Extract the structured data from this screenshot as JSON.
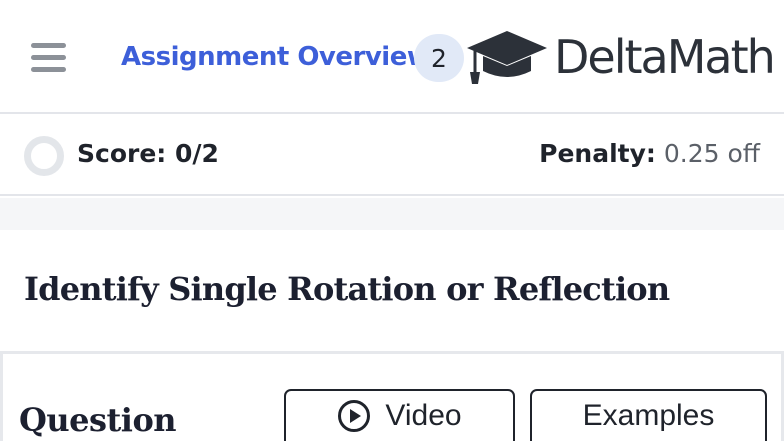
{
  "header": {
    "overview_link": "Assignment Overview",
    "overview_count": "2",
    "logo_text": "DeltaMath",
    "menu_icon": "hamburger-menu-icon",
    "logo_icon": "graduation-cap-icon"
  },
  "score_bar": {
    "score_text": "Score: 0/2",
    "score_fraction": 0,
    "penalty_label": "Penalty:",
    "penalty_value": "0.25 off"
  },
  "problem": {
    "title": "Identify Single Rotation or Reflection"
  },
  "question": {
    "heading": "Question",
    "video_label": "Video",
    "video_icon": "play-circle-icon",
    "examples_label": "Examples"
  },
  "colors": {
    "link": "#3d5fd9",
    "badge_bg": "#e1e9f7",
    "text_dark": "#1f232b",
    "divider": "#e3e5ea"
  }
}
